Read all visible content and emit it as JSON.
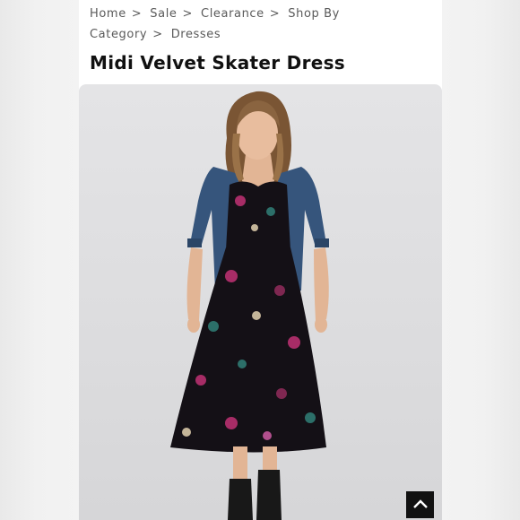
{
  "breadcrumb": {
    "items": [
      "Home",
      "Sale",
      "Clearance",
      "Shop By Category",
      "Dresses"
    ],
    "separator": ">"
  },
  "product": {
    "title": "Midi Velvet Skater Dress"
  },
  "photo": {
    "subject": "woman in black floral velvet midi dress with denim jacket"
  },
  "controls": {
    "scroll_top_icon": "chevron-up-icon"
  },
  "colors": {
    "dress": "#141016",
    "jacket": "#36557c",
    "floral_pink": "#b8306f",
    "floral_teal": "#2f7a73"
  }
}
